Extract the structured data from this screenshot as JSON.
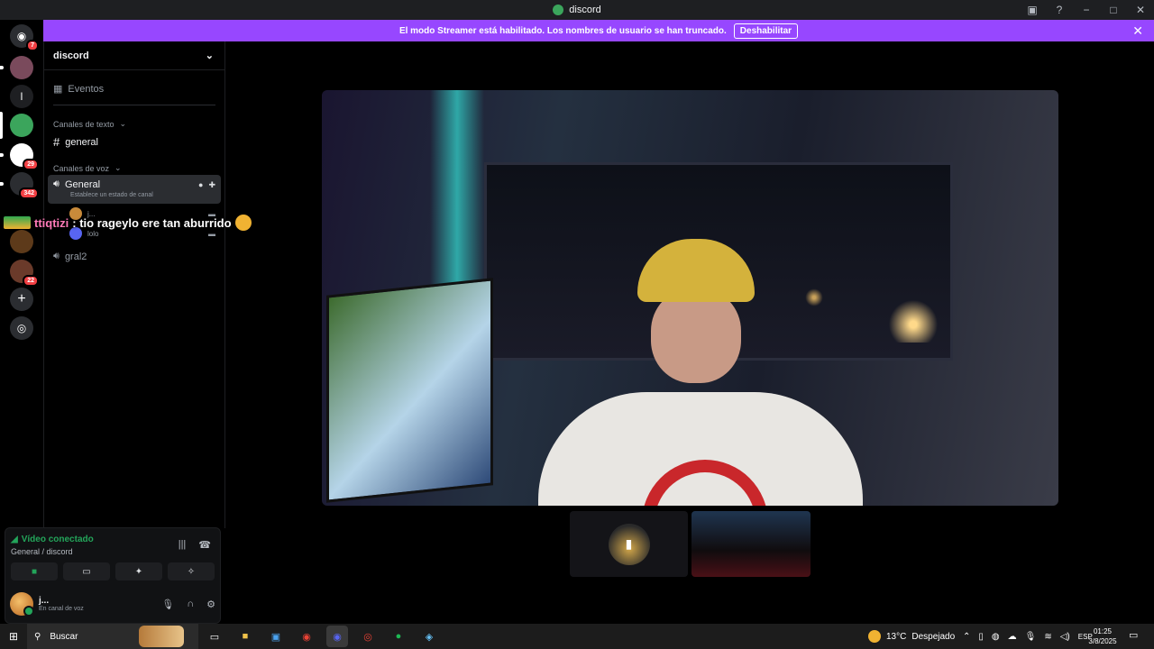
{
  "window": {
    "title": "discord",
    "controls": [
      "−",
      "□",
      "✕"
    ]
  },
  "banner": {
    "message": "El modo Streamer está habilitado. Los nombres de usuario se han truncado.",
    "button_label": "Deshabilitar",
    "close": "✕"
  },
  "servers": {
    "home_badge": "7",
    "items": [
      {
        "letter": "",
        "color": "#7a4a5c"
      },
      {
        "letter": "l",
        "color": "#1e1f22"
      },
      {
        "letter": "",
        "color": "#3ba55c"
      },
      {
        "letter": "",
        "color": "#ffffff",
        "badge": "29"
      },
      {
        "letter": "",
        "color": "#2b2d31",
        "badge": "342"
      },
      {
        "letter": "",
        "color": "#5d3a1a"
      },
      {
        "letter": "",
        "color": "#6a3a2a",
        "badge": "22"
      }
    ],
    "add": "+",
    "explore": "◎"
  },
  "guild": {
    "name": "discord",
    "events_label": "Eventos",
    "text_category": "Canales de texto",
    "text_channels": [
      "general"
    ],
    "voice_category": "Canales de voz",
    "voice_channel": {
      "name": "General",
      "status_placeholder": "Establece un estado de canal"
    },
    "voice_members": [
      "j...",
      "lolo"
    ],
    "voice_channel_2": "gral2"
  },
  "overlay_chat": {
    "username": "ttiqtizi",
    "message": ": tio rageylo ere tan aburrido"
  },
  "voice_panel": {
    "status": "Vídeo conectado",
    "location": "General / discord",
    "user": {
      "name": "j...",
      "status": "En canal de voz"
    }
  },
  "taskbar": {
    "search_label": "Buscar",
    "weather_temp": "13°C",
    "weather_desc": "Despejado",
    "language": "ESP",
    "time": "01:25",
    "date": "3/8/2025"
  },
  "colors": {
    "banner": "#9747ff",
    "connected": "#23a55a",
    "badge": "#f23f43"
  }
}
